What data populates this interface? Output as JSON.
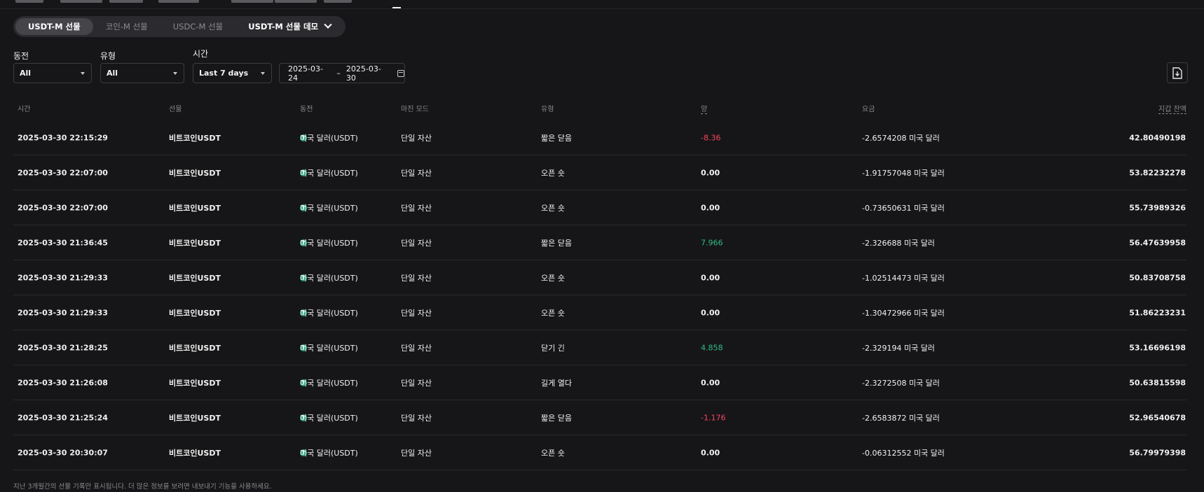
{
  "product_tabs": [
    {
      "label": "USDT-M 선물",
      "active": true
    },
    {
      "label": "코인-M 선물",
      "active": false
    },
    {
      "label": "USDC-M 선물",
      "active": false
    },
    {
      "label": "USDT-M 선물 데모",
      "active": false
    }
  ],
  "filters": {
    "coin": {
      "label": "동전",
      "value": "All"
    },
    "type": {
      "label": "유형",
      "value": "All"
    },
    "time": {
      "label": "시간",
      "value": "Last 7 days"
    },
    "date_from": "2025-03-24",
    "date_sep": "–",
    "date_to": "2025-03-30"
  },
  "icons": {
    "export": "download-file-icon",
    "calendar": "calendar-icon",
    "coin": "usdt-icon",
    "dropdown": "chevron-down-icon"
  },
  "colors": {
    "background": "#161618",
    "negative": "#f6465d",
    "positive": "#2ebd85",
    "usdt": "#26a17b"
  },
  "table": {
    "headers": {
      "time": "시간",
      "futures": "선물",
      "coin": "동전",
      "margin_mode": "마진 모드",
      "type": "유형",
      "quantity": "양",
      "fee": "요금",
      "wallet_balance": "지갑 잔액"
    },
    "rows": [
      {
        "time": "2025-03-30 22:15:29",
        "futures": "비트코인USDT",
        "coin": "미국 달러(USDT)",
        "margin": "단일 자산",
        "type": "짧은 닫음",
        "qty": "-8.36",
        "fee": "-2.6574208 미국 달러",
        "balance": "42.80490198"
      },
      {
        "time": "2025-03-30 22:07:00",
        "futures": "비트코인USDT",
        "coin": "미국 달러(USDT)",
        "margin": "단일 자산",
        "type": "오픈 숏",
        "qty": "0.00",
        "fee": "-1.91757048 미국 달러",
        "balance": "53.82232278"
      },
      {
        "time": "2025-03-30 22:07:00",
        "futures": "비트코인USDT",
        "coin": "미국 달러(USDT)",
        "margin": "단일 자산",
        "type": "오픈 숏",
        "qty": "0.00",
        "fee": "-0.73650631 미국 달러",
        "balance": "55.73989326"
      },
      {
        "time": "2025-03-30 21:36:45",
        "futures": "비트코인USDT",
        "coin": "미국 달러(USDT)",
        "margin": "단일 자산",
        "type": "짧은 닫음",
        "qty": "7.966",
        "fee": "-2.326688 미국 달러",
        "balance": "56.47639958"
      },
      {
        "time": "2025-03-30 21:29:33",
        "futures": "비트코인USDT",
        "coin": "미국 달러(USDT)",
        "margin": "단일 자산",
        "type": "오픈 숏",
        "qty": "0.00",
        "fee": "-1.02514473 미국 달러",
        "balance": "50.83708758"
      },
      {
        "time": "2025-03-30 21:29:33",
        "futures": "비트코인USDT",
        "coin": "미국 달러(USDT)",
        "margin": "단일 자산",
        "type": "오픈 숏",
        "qty": "0.00",
        "fee": "-1.30472966 미국 달러",
        "balance": "51.86223231"
      },
      {
        "time": "2025-03-30 21:28:25",
        "futures": "비트코인USDT",
        "coin": "미국 달러(USDT)",
        "margin": "단일 자산",
        "type": "닫기 긴",
        "qty": "4.858",
        "fee": "-2.329194 미국 달러",
        "balance": "53.16696198"
      },
      {
        "time": "2025-03-30 21:26:08",
        "futures": "비트코인USDT",
        "coin": "미국 달러(USDT)",
        "margin": "단일 자산",
        "type": "길게 열다",
        "qty": "0.00",
        "fee": "-2.3272508 미국 달러",
        "balance": "50.63815598"
      },
      {
        "time": "2025-03-30 21:25:24",
        "futures": "비트코인USDT",
        "coin": "미국 달러(USDT)",
        "margin": "단일 자산",
        "type": "짧은 닫음",
        "qty": "-1.176",
        "fee": "-2.6583872 미국 달러",
        "balance": "52.96540678"
      },
      {
        "time": "2025-03-30 20:30:07",
        "futures": "비트코인USDT",
        "coin": "미국 달러(USDT)",
        "margin": "단일 자산",
        "type": "오픈 숏",
        "qty": "0.00",
        "fee": "-0.06312552 미국 달러",
        "balance": "56.79979398"
      }
    ]
  },
  "footer_note": "지난 3개월간의 선물 기록만 표시됩니다. 더 많은 정보를 보려면 내보내기 기능을 사용하세요."
}
